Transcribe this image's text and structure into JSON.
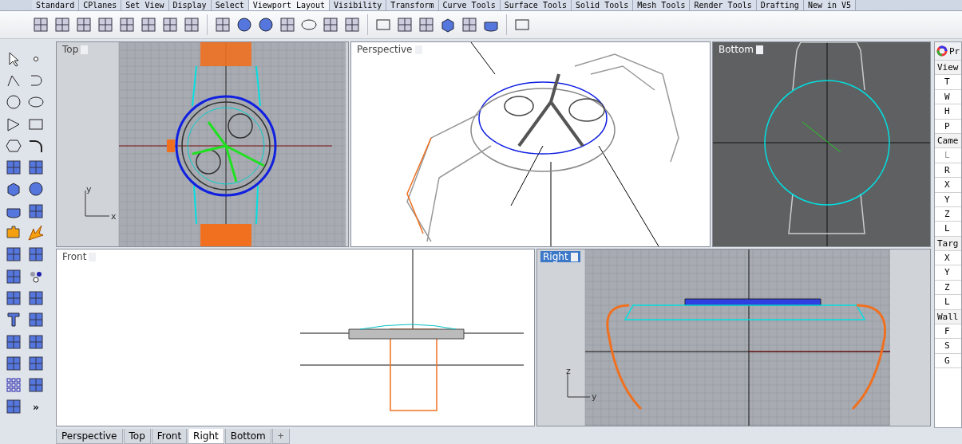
{
  "ribbon_tabs": [
    {
      "label": "Standard",
      "selected": false
    },
    {
      "label": "CPlanes",
      "selected": false
    },
    {
      "label": "Set View",
      "selected": false
    },
    {
      "label": "Display",
      "selected": false
    },
    {
      "label": "Select",
      "selected": false
    },
    {
      "label": "Viewport Layout",
      "selected": true
    },
    {
      "label": "Visibility",
      "selected": false
    },
    {
      "label": "Transform",
      "selected": false
    },
    {
      "label": "Curve Tools",
      "selected": false
    },
    {
      "label": "Surface Tools",
      "selected": false
    },
    {
      "label": "Solid Tools",
      "selected": false
    },
    {
      "label": "Mesh Tools",
      "selected": false
    },
    {
      "label": "Render Tools",
      "selected": false
    },
    {
      "label": "Drafting",
      "selected": false
    },
    {
      "label": "New in V5",
      "selected": false
    }
  ],
  "sidebar": {
    "overflow": "»"
  },
  "viewports": [
    {
      "title": "Top",
      "kind": "top",
      "active": false,
      "axes": [
        "y",
        "x"
      ]
    },
    {
      "title": "Perspective",
      "kind": "perspective",
      "active": false
    },
    {
      "title": "Bottom",
      "kind": "bottom",
      "active": false
    },
    {
      "title": "Front",
      "kind": "front",
      "active": false
    },
    {
      "title": "Right",
      "kind": "right",
      "active": true,
      "axes": [
        "z",
        "y"
      ]
    }
  ],
  "properties": {
    "title": "Pr",
    "rows": [
      {
        "kind": "section",
        "label": "View"
      },
      {
        "kind": "field",
        "label": "T",
        "disabled": false
      },
      {
        "kind": "field",
        "label": "W",
        "disabled": false
      },
      {
        "kind": "field",
        "label": "H",
        "disabled": false
      },
      {
        "kind": "field",
        "label": "P",
        "disabled": false
      },
      {
        "kind": "section",
        "label": "Came"
      },
      {
        "kind": "field",
        "label": "L",
        "disabled": true
      },
      {
        "kind": "field",
        "label": "R",
        "disabled": false
      },
      {
        "kind": "field",
        "label": "X",
        "disabled": false
      },
      {
        "kind": "field",
        "label": "Y",
        "disabled": false
      },
      {
        "kind": "field",
        "label": "Z",
        "disabled": false
      },
      {
        "kind": "field",
        "label": "L",
        "disabled": false
      },
      {
        "kind": "section",
        "label": "Targ"
      },
      {
        "kind": "field",
        "label": "X",
        "disabled": false
      },
      {
        "kind": "field",
        "label": "Y",
        "disabled": false
      },
      {
        "kind": "field",
        "label": "Z",
        "disabled": false
      },
      {
        "kind": "field",
        "label": "L",
        "disabled": false
      },
      {
        "kind": "section",
        "label": "Wall"
      },
      {
        "kind": "field",
        "label": "F",
        "disabled": false
      },
      {
        "kind": "field",
        "label": "S",
        "disabled": false
      },
      {
        "kind": "field",
        "label": "G",
        "disabled": false
      }
    ]
  },
  "view_tabs": [
    {
      "label": "Perspective",
      "selected": false
    },
    {
      "label": "Top",
      "selected": false
    },
    {
      "label": "Front",
      "selected": false
    },
    {
      "label": "Right",
      "selected": true
    },
    {
      "label": "Bottom",
      "selected": false
    }
  ],
  "add_tab": "+"
}
